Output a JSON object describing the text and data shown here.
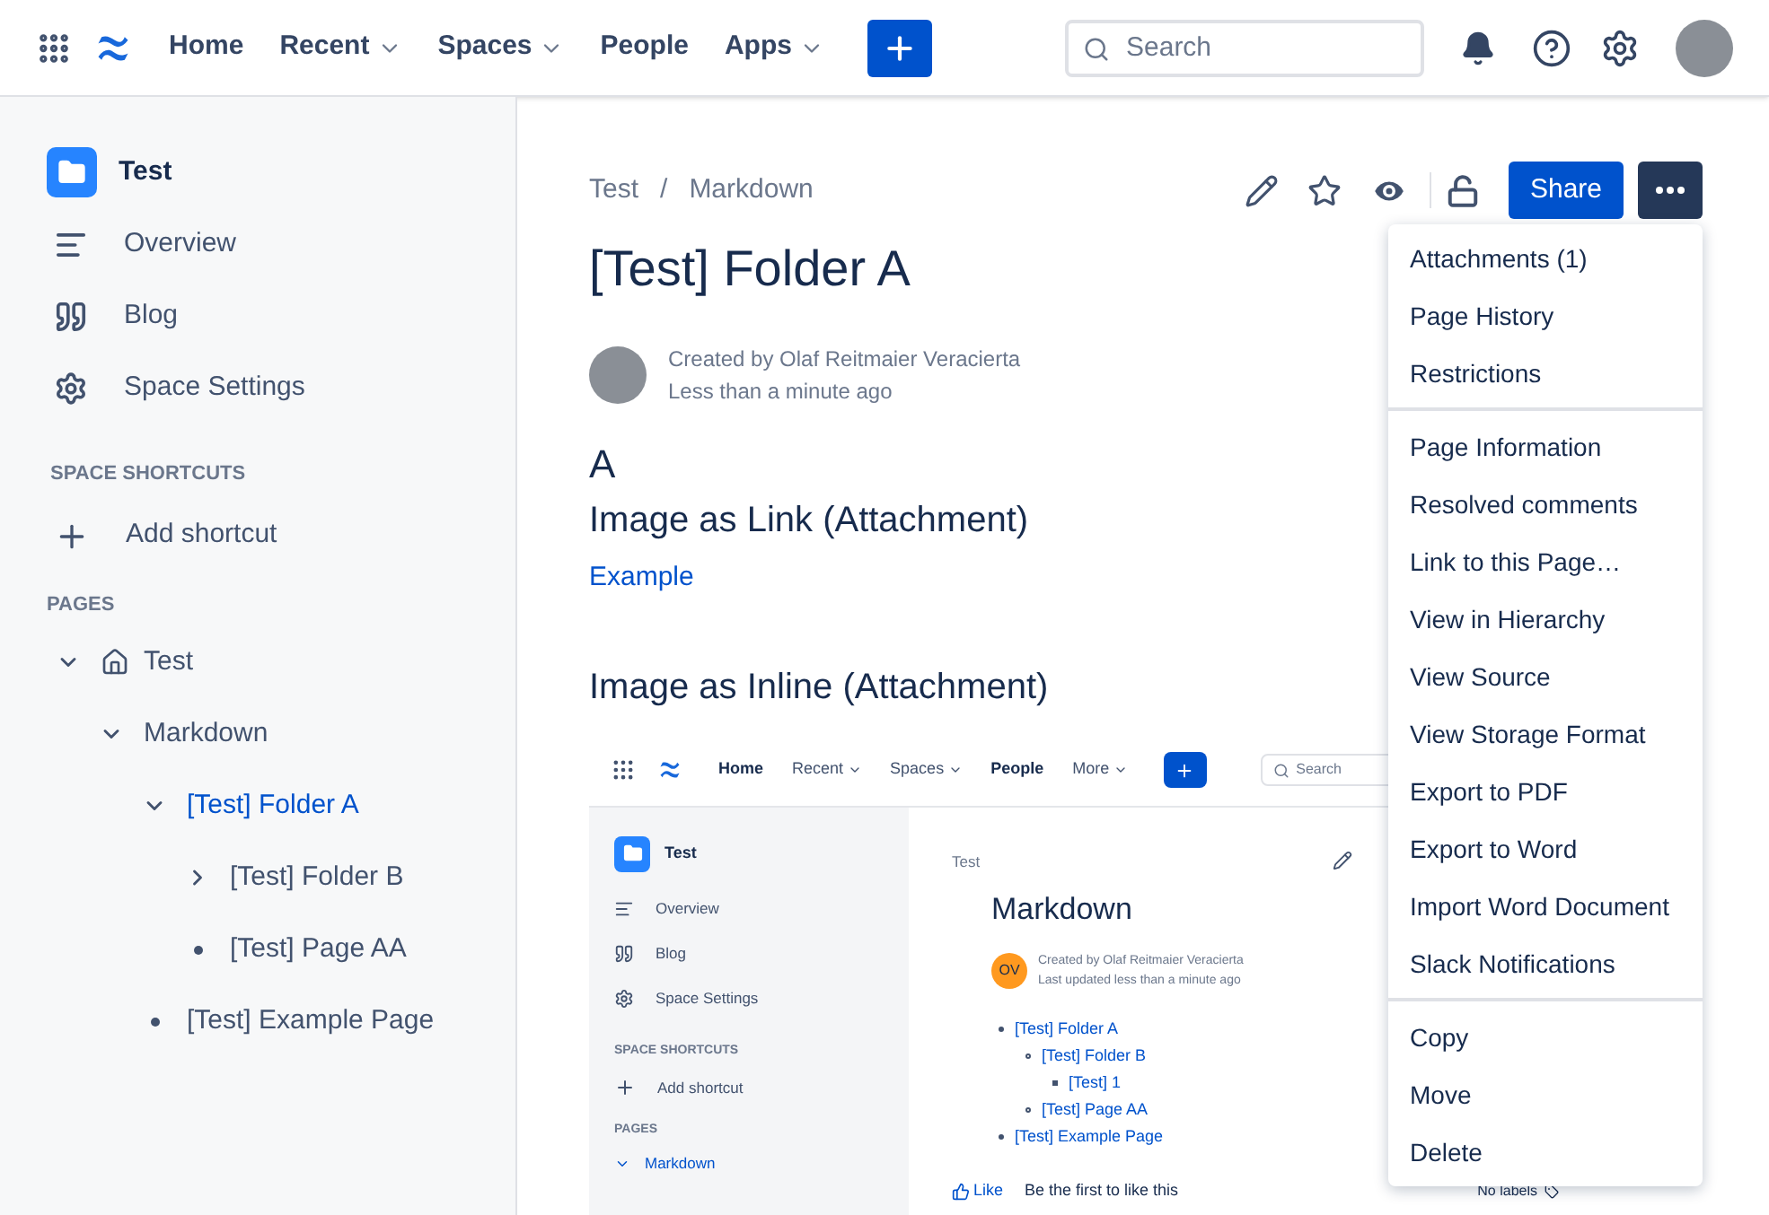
{
  "top_nav": {
    "items": [
      {
        "label": "Home",
        "dropdown": false
      },
      {
        "label": "Recent",
        "dropdown": true
      },
      {
        "label": "Spaces",
        "dropdown": true
      },
      {
        "label": "People",
        "dropdown": false
      },
      {
        "label": "Apps",
        "dropdown": true
      }
    ],
    "search": {
      "placeholder": "Search"
    }
  },
  "sidebar": {
    "space": "Test",
    "items": [
      "Overview",
      "Blog",
      "Space Settings"
    ],
    "shortcuts_heading": "SPACE SHORTCUTS",
    "add_shortcut": "Add shortcut",
    "pages_heading": "PAGES",
    "tree": [
      {
        "label": "Test",
        "kind": "home",
        "expanded": true,
        "selected": false,
        "children": [
          {
            "label": "Markdown",
            "kind": "folder",
            "expanded": true,
            "selected": false,
            "children": [
              {
                "label": "[Test] Folder A",
                "kind": "folder",
                "expanded": true,
                "selected": true,
                "children": [
                  {
                    "label": "[Test] Folder B",
                    "kind": "folder",
                    "expanded": false,
                    "selected": false
                  },
                  {
                    "label": "[Test] Page AA",
                    "kind": "page",
                    "selected": false
                  }
                ]
              },
              {
                "label": "[Test] Example Page",
                "kind": "page",
                "selected": false
              }
            ]
          }
        ]
      }
    ]
  },
  "page": {
    "breadcrumbs": [
      "Test",
      "Markdown"
    ],
    "breadcrumb_separator": "/",
    "share": "Share",
    "title": "[Test] Folder A",
    "byline": "Created by Olaf Reitmaier Veracierta",
    "updated": "Less than a minute ago",
    "heading_1": "A",
    "heading_2": "Image as Link (Attachment)",
    "link": "Example",
    "heading_3": "Image as Inline (Attachment)"
  },
  "embedded_screenshot": {
    "nav": [
      {
        "label": "Home",
        "dropdown": false
      },
      {
        "label": "Recent",
        "dropdown": true
      },
      {
        "label": "Spaces",
        "dropdown": true
      },
      {
        "label": "People",
        "dropdown": false
      },
      {
        "label": "More",
        "dropdown": true
      }
    ],
    "search": "Search",
    "space": "Test",
    "items": [
      "Overview",
      "Blog",
      "Space Settings"
    ],
    "shortcuts_heading": "SPACE SHORTCUTS",
    "add_shortcut": "Add shortcut",
    "pages_heading": "PAGES",
    "tree_item": "Markdown",
    "breadcrumb": "Test",
    "title": "Markdown",
    "avatar": "OV",
    "byline": "Created by Olaf Reitmaier Veracierta",
    "updated": "Last updated less than a minute ago",
    "list": [
      {
        "label": "[Test] Folder A",
        "children": [
          {
            "label": "[Test] Folder B",
            "children": [
              {
                "label": "[Test] 1"
              }
            ]
          },
          {
            "label": "[Test] Page AA"
          }
        ]
      },
      {
        "label": "[Test] Example Page"
      }
    ],
    "like": "Like",
    "like_note": "Be the first to like this",
    "labels": "No labels"
  },
  "menu": {
    "groups": [
      [
        "Attachments (1)",
        "Page History",
        "Restrictions"
      ],
      [
        "Page Information",
        "Resolved comments",
        "Link to this Page…",
        "View in Hierarchy",
        "View Source",
        "View Storage Format",
        "Export to PDF",
        "Export to Word",
        "Import Word Document",
        "Slack Notifications"
      ],
      [
        "Copy",
        "Move",
        "Delete"
      ]
    ]
  }
}
